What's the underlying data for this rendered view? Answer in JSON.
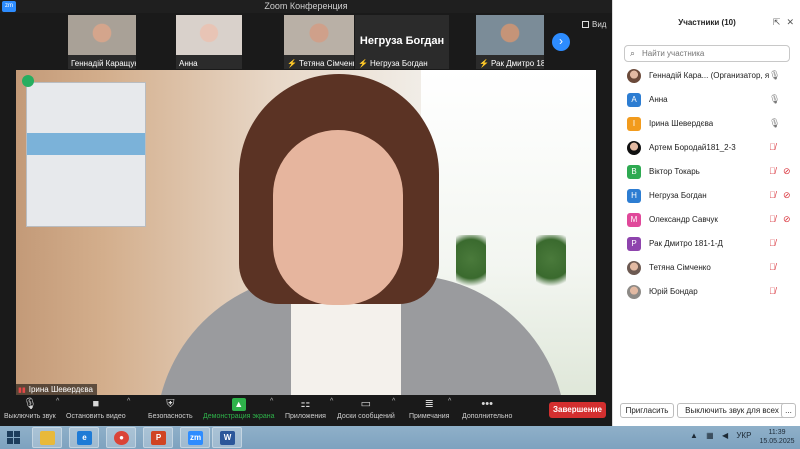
{
  "window": {
    "title": "Zoom Конференция",
    "app_icon": "zm"
  },
  "thumbnails": [
    {
      "name": "Геннадій Каращук",
      "muted": false,
      "skin": "#d4a58c",
      "bg": "#a9a197"
    },
    {
      "name": "Анна",
      "muted": false,
      "skin": "#e8c4b5",
      "bg": "#d9d1cb"
    },
    {
      "name": "Тетяна Сімченко",
      "muted": true,
      "skin": "#cfa08a",
      "bg": "#b9b0a6"
    },
    {
      "name": "Негруза Богдан",
      "muted": true,
      "text_only": true,
      "big": "Негруза Богдан"
    },
    {
      "name": "Рак Дмитро 181-1-Д",
      "muted": true,
      "skin": "#c59478",
      "bg": "#7b8c98"
    }
  ],
  "view_button": "Вид",
  "active_speaker": {
    "name": "Ірина Шевердєва"
  },
  "toolbar": {
    "items": [
      {
        "id": "mute",
        "label": "Выключить звук",
        "icon": "microphone-icon",
        "glyph": "🎙"
      },
      {
        "id": "video",
        "label": "Остановить видео",
        "icon": "video-camera-icon",
        "glyph": "■"
      },
      {
        "id": "security",
        "label": "Безопасность",
        "icon": "shield-icon",
        "glyph": "⛨"
      },
      {
        "id": "share",
        "label": "Демонстрация экрана",
        "icon": "share-screen-icon",
        "glyph": "▲"
      },
      {
        "id": "apps",
        "label": "Приложения",
        "icon": "apps-icon",
        "glyph": "⚏"
      },
      {
        "id": "whiteboards",
        "label": "Доски сообщений",
        "icon": "whiteboard-icon",
        "glyph": "▭"
      },
      {
        "id": "notes",
        "label": "Примечания",
        "icon": "notes-icon",
        "glyph": "≣"
      },
      {
        "id": "more",
        "label": "Дополнительно",
        "icon": "more-icon",
        "glyph": "•••"
      }
    ],
    "end_button": "Завершение"
  },
  "panel": {
    "title": "Участники (10)",
    "search_placeholder": "Найти участника",
    "participants": [
      {
        "name": "Геннадій Кара... (Организатор, я)",
        "avatar": "",
        "color": "#6b4a3a",
        "photo": true,
        "mic_muted": false,
        "cam_off": false
      },
      {
        "name": "Анна",
        "avatar": "А",
        "color": "#2d7dd2",
        "photo": false,
        "mic_muted": false,
        "cam_off": false
      },
      {
        "name": "Ірина Шевердєва",
        "avatar": "І",
        "color": "#f29b1d",
        "photo": false,
        "mic_muted": false,
        "cam_off": false
      },
      {
        "name": "Артем Бородай181_2-3",
        "avatar": "",
        "color": "#111111",
        "photo": true,
        "mic_muted": true,
        "cam_off": false
      },
      {
        "name": "Віктор Токарь",
        "avatar": "В",
        "color": "#2eaa52",
        "photo": false,
        "mic_muted": true,
        "cam_off": true
      },
      {
        "name": "Негруза Богдан",
        "avatar": "Н",
        "color": "#2d7dd2",
        "photo": false,
        "mic_muted": true,
        "cam_off": true
      },
      {
        "name": "Олександр Савчук",
        "avatar": "М",
        "color": "#e0489a",
        "photo": false,
        "mic_muted": true,
        "cam_off": true
      },
      {
        "name": "Рак Дмитро 181-1-Д",
        "avatar": "Р",
        "color": "#8e44ad",
        "photo": false,
        "mic_muted": true,
        "cam_off": false
      },
      {
        "name": "Тетяна Сімченко",
        "avatar": "",
        "color": "#6d5a52",
        "photo": true,
        "mic_muted": true,
        "cam_off": false
      },
      {
        "name": "Юрій Бондар",
        "avatar": "",
        "color": "#8d8a86",
        "photo": true,
        "mic_muted": true,
        "cam_off": false
      }
    ],
    "invite_button": "Пригласить",
    "mute_all_button": "Выключить звук для всех",
    "more_button": "..."
  },
  "taskbar": {
    "apps": [
      {
        "name": "file-explorer",
        "glyph": "",
        "color": "#e8b93a"
      },
      {
        "name": "internet-explorer",
        "glyph": "e",
        "color": "#1e7bd6"
      },
      {
        "name": "chrome",
        "glyph": "●",
        "color": "#db4437"
      },
      {
        "name": "powerpoint",
        "glyph": "P",
        "color": "#d04423"
      },
      {
        "name": "zoom",
        "glyph": "zm",
        "color": "#2d8cff"
      },
      {
        "name": "word",
        "glyph": "W",
        "color": "#2b579a"
      }
    ],
    "language": "УКР",
    "time": "11:39",
    "date": "15.05.2025"
  }
}
